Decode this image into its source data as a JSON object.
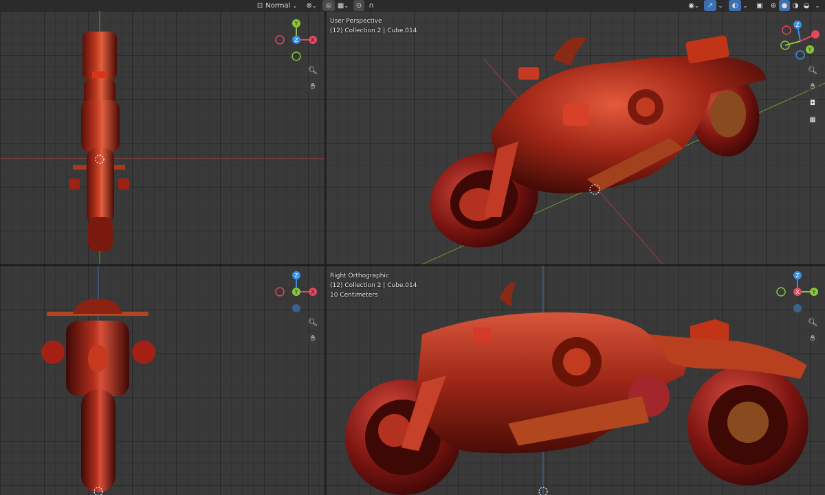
{
  "header": {
    "transform_orientation": "Normal",
    "icons": [
      "transform-orientation-icon",
      "link-icon",
      "proportional-edit-icon",
      "snap-icon",
      "pivot-icon",
      "falloff-icon",
      "visibility-icon",
      "gizmo-icon",
      "overlay-icon",
      "xray-icon",
      "shading-wireframe-icon",
      "shading-solid-icon",
      "shading-material-icon",
      "shading-rendered-icon"
    ]
  },
  "viewports": {
    "top_left": {
      "view": "",
      "collection": "",
      "gizmo": {
        "center": "Z",
        "up": "Y",
        "right": "X"
      }
    },
    "top_right": {
      "view": "User Perspective",
      "collection": "(12) Collection 2 | Cube.014",
      "gizmo": {
        "up": "Z",
        "right": "Y"
      }
    },
    "bottom_left": {
      "view": "",
      "collection": "",
      "gizmo": {
        "center": "Y",
        "up": "Z",
        "right": "X"
      }
    },
    "bottom_right": {
      "view": "Right Orthographic",
      "collection": "(12) Collection 2 | Cube.014",
      "scale": "10 Centimeters",
      "gizmo": {
        "center": "X",
        "up": "Z",
        "right": "Y"
      }
    }
  },
  "colors": {
    "x_axis": "#e5485b",
    "y_axis": "#8cc63e",
    "z_axis": "#3b8fe3",
    "model": "#b5301e",
    "header_blue": "#3d6fb3"
  }
}
